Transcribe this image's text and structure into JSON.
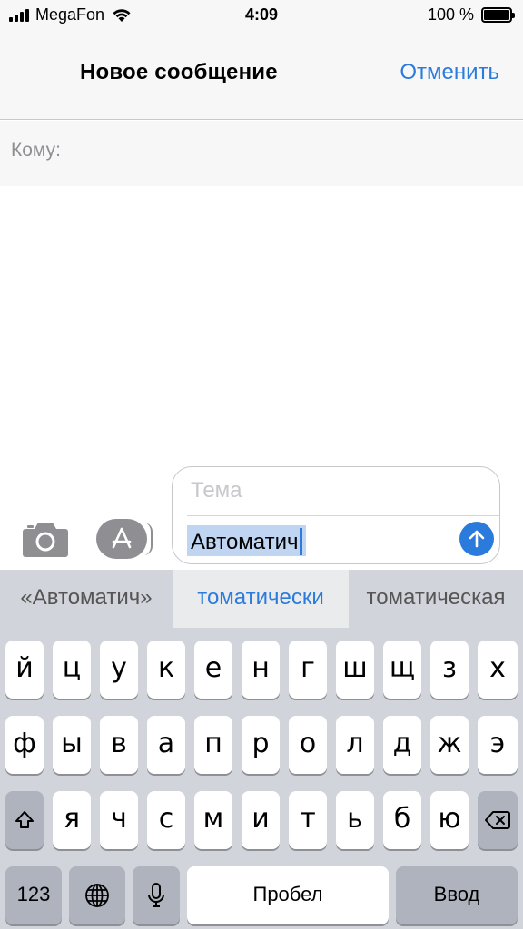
{
  "status_bar": {
    "carrier": "MegaFon",
    "time": "4:09",
    "battery_text": "100 %",
    "battery_level": 1.0
  },
  "nav": {
    "title": "Новое сообщение",
    "cancel_label": "Отменить"
  },
  "recipient": {
    "label": "Кому:"
  },
  "compose": {
    "subject_placeholder": "Тема",
    "body_text": "Автоматич"
  },
  "icons": {
    "camera": "camera-icon",
    "app_store": "app-store-icon",
    "send": "send-arrow-icon",
    "shift": "shift-icon",
    "backspace": "backspace-icon",
    "globe": "globe-icon",
    "mic": "microphone-icon"
  },
  "colors": {
    "accent": "#2b7bdc",
    "keyboard_bg": "#d1d4da",
    "selection": "#bfd5f1"
  },
  "keyboard": {
    "suggestions": [
      "«Автоматич»",
      "томатически",
      "томатическая"
    ],
    "row1": [
      "й",
      "ц",
      "у",
      "к",
      "е",
      "н",
      "г",
      "ш",
      "щ",
      "з",
      "х"
    ],
    "row2": [
      "ф",
      "ы",
      "в",
      "а",
      "п",
      "р",
      "о",
      "л",
      "д",
      "ж",
      "э"
    ],
    "row3": [
      "я",
      "ч",
      "с",
      "м",
      "и",
      "т",
      "ь",
      "б",
      "ю"
    ],
    "numbers_label": "123",
    "space_label": "Пробел",
    "return_label": "Ввод"
  }
}
